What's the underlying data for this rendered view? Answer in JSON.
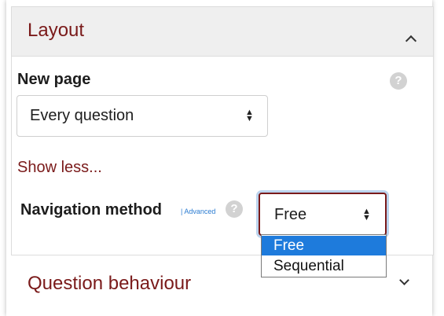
{
  "layout_section": {
    "title": "Layout",
    "new_page": {
      "label": "New page",
      "selected": "Every question"
    },
    "show_less_link": "Show less...",
    "navigation_method": {
      "label": "Navigation method",
      "advanced_tag": "Advanced",
      "selected": "Free",
      "options": [
        "Free",
        "Sequential"
      ],
      "highlighted_option": "Free"
    }
  },
  "question_behaviour_section": {
    "title": "Question behaviour"
  },
  "icons": {
    "help": "?",
    "collapse": "chevron-up-icon",
    "expand": "chevron-down-icon",
    "select_arrows": "sort-arrows-icon"
  },
  "colors": {
    "accent": "#7a1a1a",
    "highlight": "#1e7bdc",
    "header_bg": "#efefef",
    "advanced_tag": "#2a7bd1"
  }
}
